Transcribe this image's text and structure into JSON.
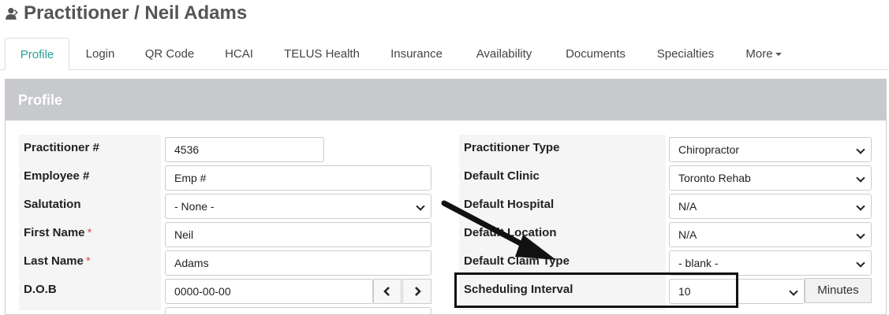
{
  "header": {
    "title": "Practitioner / Neil Adams",
    "icon": "user-icon"
  },
  "tabs": [
    {
      "label": "Profile",
      "active": true
    },
    {
      "label": "Login"
    },
    {
      "label": "QR Code"
    },
    {
      "label": "HCAI"
    },
    {
      "label": "TELUS Health"
    },
    {
      "label": "Insurance"
    },
    {
      "label": "Availability"
    },
    {
      "label": "Documents"
    },
    {
      "label": "Specialties"
    },
    {
      "label": "More"
    }
  ],
  "panel": {
    "title": "Profile"
  },
  "left_fields": [
    {
      "label": "Practitioner #",
      "value": "4536",
      "type": "text"
    },
    {
      "label": "Employee #",
      "value": "Emp #",
      "type": "text"
    },
    {
      "label": "Salutation",
      "value": "- None -",
      "type": "select"
    },
    {
      "label": "First Name",
      "value": "Neil",
      "type": "text",
      "required": true
    },
    {
      "label": "Last Name",
      "value": "Adams",
      "type": "text",
      "required": true
    },
    {
      "label": "D.O.B",
      "value": "0000-00-00",
      "type": "date"
    }
  ],
  "right_fields": [
    {
      "label": "Practitioner Type",
      "value": "Chiropractor"
    },
    {
      "label": "Default Clinic",
      "value": "Toronto Rehab"
    },
    {
      "label": "Default Hospital",
      "value": "N/A"
    },
    {
      "label": "Default Location",
      "value": "N/A"
    },
    {
      "label": "Default Claim Type",
      "value": "- blank -"
    },
    {
      "label": "Scheduling Interval",
      "value": "10",
      "addon": "Minutes"
    }
  ],
  "required_mark": "*",
  "colors": {
    "accent": "#2aa198",
    "panel_header": "#c7c9cc",
    "required": "#d9534f"
  }
}
